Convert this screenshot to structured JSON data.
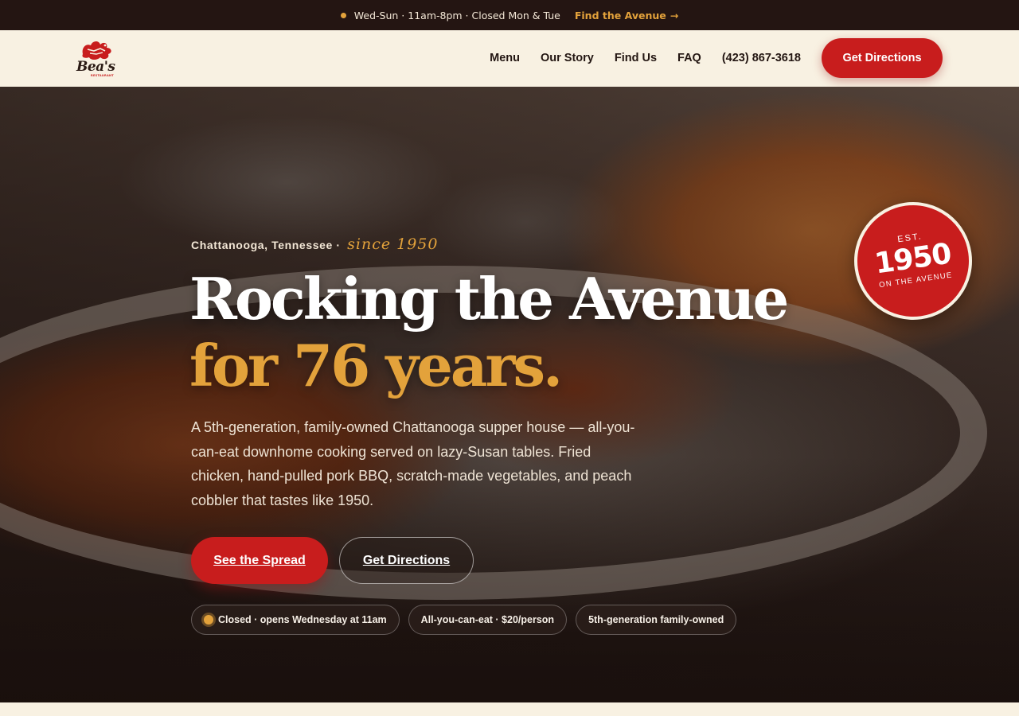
{
  "topbar": {
    "hours": "Wed-Sun · 11am-8pm · Closed Mon & Tue",
    "link_label": "Find the Avenue",
    "link_arrow": "→",
    "accent": "#e3a23b"
  },
  "header": {
    "logo_text": "Bea's",
    "logo_sub": "RESTAURANT",
    "logo_icon": "rooster-icon",
    "nav": [
      "Menu",
      "Our Story",
      "Find Us",
      "FAQ"
    ],
    "phone": "(423) 867-3618",
    "cta": "Get Directions",
    "brand_red": "#c81d1d"
  },
  "hero": {
    "eyebrow": "Chattanooga, Tennessee ·",
    "eyebrow_script": "since 1950",
    "headline_line1": "Rocking the Avenue",
    "headline_line2": "for 76 years.",
    "lede": "A 5th-generation, family-owned Chattanooga supper house — all-you-can-eat downhome cooking served on lazy-Susan tables. Fried chicken, hand-pulled pork BBQ, scratch-made vegetables, and peach cobbler that tastes like 1950.",
    "primary_cta": "See the Spread",
    "secondary_cta": "Get Directions",
    "pills": [
      "Closed · opens Wednesday at 11am",
      "All-you-can-eat · $20/person",
      "5th-generation family-owned"
    ],
    "badge": {
      "est": "EST.",
      "year": "1950",
      "sub": "ON THE AVENUE"
    }
  }
}
